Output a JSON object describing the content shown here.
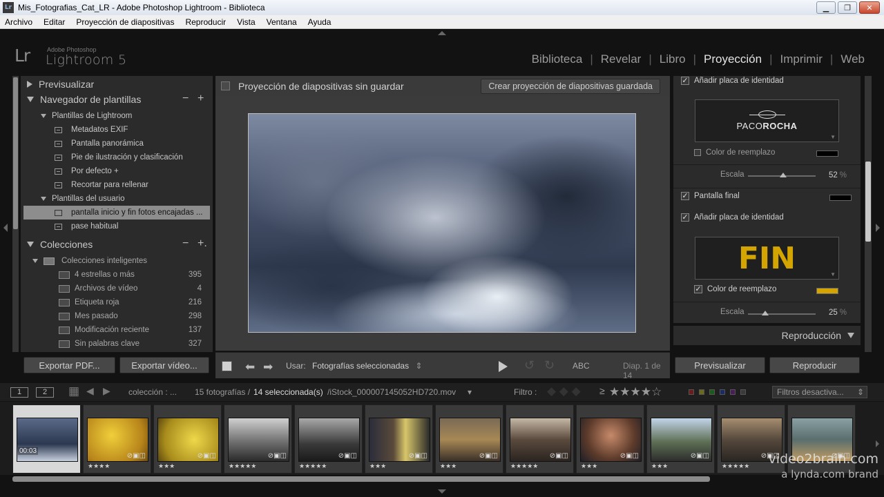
{
  "window": {
    "title": "Mis_Fotografias_Cat_LR - Adobe Photoshop Lightroom - Biblioteca",
    "app_icon": "Lr",
    "minimize": "▁",
    "restore": "❐",
    "close": "✕"
  },
  "menu": [
    "Archivo",
    "Editar",
    "Proyección de diapositivas",
    "Reproducir",
    "Vista",
    "Ventana",
    "Ayuda"
  ],
  "identity": {
    "logo": "Lr",
    "sub": "Adobe Photoshop",
    "name": "Lightroom 5"
  },
  "modules": {
    "items": [
      "Biblioteca",
      "Revelar",
      "Libro",
      "Proyección",
      "Imprimir",
      "Web"
    ],
    "active": "Proyección",
    "separator": "|"
  },
  "left_panel": {
    "preview_label": "Previsualizar",
    "navigator_label": "Navegador de plantillas",
    "navigator_minus": "−",
    "navigator_plus": "+",
    "folder_lightroom": "Plantillas de Lightroom",
    "lightroom_templates": [
      "Metadatos EXIF",
      "Pantalla panorámica",
      "Pie de ilustración y clasificación",
      "Por defecto  +",
      "Recortar para rellenar"
    ],
    "folder_user": "Plantillas del usuario",
    "user_templates": [
      "pantalla inicio y fin fotos encajadas ...",
      "pase habitual"
    ],
    "selected_template": "pantalla inicio y fin fotos encajadas ...",
    "collections_label": "Colecciones",
    "collections_minus": "−",
    "collections_plus": "+.",
    "smart_folder": "Colecciones inteligentes",
    "collections": [
      {
        "name": "4 estrellas o más",
        "count": "395"
      },
      {
        "name": "Archivos de vídeo",
        "count": "4"
      },
      {
        "name": "Etiqueta roja",
        "count": "216"
      },
      {
        "name": "Mes pasado",
        "count": "298"
      },
      {
        "name": "Modificación reciente",
        "count": "137"
      },
      {
        "name": "Sin palabras clave",
        "count": "327"
      }
    ],
    "export_pdf": "Exportar PDF...",
    "export_video": "Exportar vídeo..."
  },
  "center": {
    "title": "Proyección de diapositivas sin guardar",
    "save_button": "Crear proyección de diapositivas guardada",
    "use_label": "Usar:",
    "use_value": "Fotografías seleccionadas",
    "use_chevron": "⇕",
    "abc": "ABC",
    "slide_counter": "Diap. 1 de 14",
    "prev_arrow": "⬅",
    "next_arrow": "➡",
    "rotate_left": "↺",
    "rotate_right": "↻"
  },
  "right_panel": {
    "add_plate_1": "Añadir placa de identidad",
    "plate_1_text_a": "PACO",
    "plate_1_text_b": "ROCHA",
    "replace_color_1": "Color de reemplazo",
    "replace_color_1_checked": false,
    "scale_label_1": "Escala",
    "scale_value_1": "52",
    "scale_1": 0.52,
    "percent": "%",
    "final_screen": "Pantalla final",
    "final_screen_color": "#000000",
    "add_plate_2": "Añadir placa de identidad",
    "plate_2_text": "FIN",
    "replace_color_2": "Color de reemplazo",
    "replace_color_2_checked": true,
    "replace_color_2_swatch": "#d4a500",
    "scale_label_2": "Escala",
    "scale_value_2": "25",
    "scale_2": 0.25,
    "playback_header": "Reproducción",
    "check_mark": "✓",
    "preview_button": "Previsualizar",
    "play_button": "Reproducir"
  },
  "filmstrip_header": {
    "view1": "1",
    "view2": "2",
    "grid_icon": "▦",
    "back": "◀",
    "forward": "▶",
    "source": "colección : ...",
    "count_text": "15 fotografías /",
    "selected_text": "14 seleccionada(s)",
    "filename": "/iStock_000007145052HD720.mov",
    "file_chevron": "▾",
    "filter_label": "Filtro :",
    "gte": "≥",
    "stars": "★★★★☆",
    "filter_value": "Filtros desactiva...",
    "filter_toggle": "⇕"
  },
  "filmstrip": {
    "items": [
      {
        "stars": "",
        "duration": "00:03",
        "selected": true,
        "kind": "sky"
      },
      {
        "stars": "★★★★",
        "kind": "leaves"
      },
      {
        "stars": "★★★",
        "kind": "leaves2"
      },
      {
        "stars": "★★★★★",
        "kind": "bw"
      },
      {
        "stars": "★★★★★",
        "kind": "bw2"
      },
      {
        "stars": "★★★",
        "kind": "people"
      },
      {
        "stars": "★★★",
        "kind": "band"
      },
      {
        "stars": "★★★★★",
        "kind": "crowd"
      },
      {
        "stars": "★★★",
        "kind": "portrait"
      },
      {
        "stars": "★★★",
        "kind": "men"
      },
      {
        "stars": "★★★★★",
        "kind": "street"
      },
      {
        "stars": "",
        "kind": "lake"
      }
    ],
    "badges": "⊘▣◫"
  },
  "watermark": {
    "line1": "video2brain.com",
    "line2": "a lynda.com brand"
  },
  "colors": {
    "accent_plate": "#d4a500",
    "panel": "#2b2b2b"
  }
}
